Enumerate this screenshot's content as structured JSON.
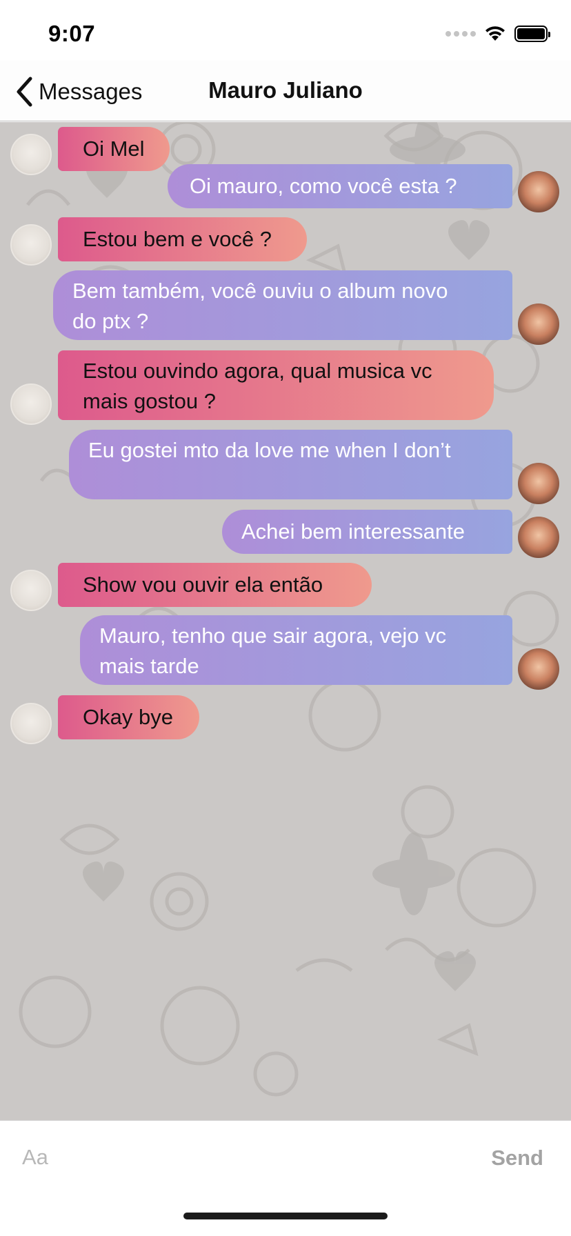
{
  "status_bar": {
    "time": "9:07"
  },
  "nav": {
    "back_label": "Messages",
    "title": "Mauro Juliano"
  },
  "messages": [
    {
      "dir": "in",
      "lines": [
        "Oi Mel"
      ]
    },
    {
      "dir": "out",
      "lines": [
        "Oi mauro, como você esta ?"
      ]
    },
    {
      "dir": "in",
      "lines": [
        "Estou bem e você ?"
      ]
    },
    {
      "dir": "out",
      "lines": [
        "Bem também, você ouviu o album novo",
        "do ptx ?"
      ]
    },
    {
      "dir": "in",
      "lines": [
        "Estou ouvindo agora, qual musica vc",
        "mais gostou ?"
      ]
    },
    {
      "dir": "out",
      "lines": [
        "Eu gostei mto da love me when I don’t",
        ""
      ]
    },
    {
      "dir": "out",
      "lines": [
        "Achei bem interessante"
      ]
    },
    {
      "dir": "in",
      "lines": [
        "Show vou ouvir ela então"
      ]
    },
    {
      "dir": "out",
      "lines": [
        "Mauro, tenho que sair agora, vejo vc",
        "mais tarde"
      ]
    },
    {
      "dir": "in",
      "lines": [
        "Okay bye"
      ]
    }
  ],
  "input": {
    "placeholder": "Aa",
    "value": "",
    "send_label": "Send"
  },
  "colors": {
    "incoming_gradient": [
      "#dd5a8c",
      "#ef9a8d"
    ],
    "outgoing_gradient": [
      "#ae8ed8",
      "#97a4df"
    ],
    "chat_background": "#cbc8c6"
  },
  "icons": {
    "back": "chevron-left-icon",
    "wifi": "wifi-icon",
    "battery": "battery-icon",
    "signal": "cellular-signal-icon"
  }
}
